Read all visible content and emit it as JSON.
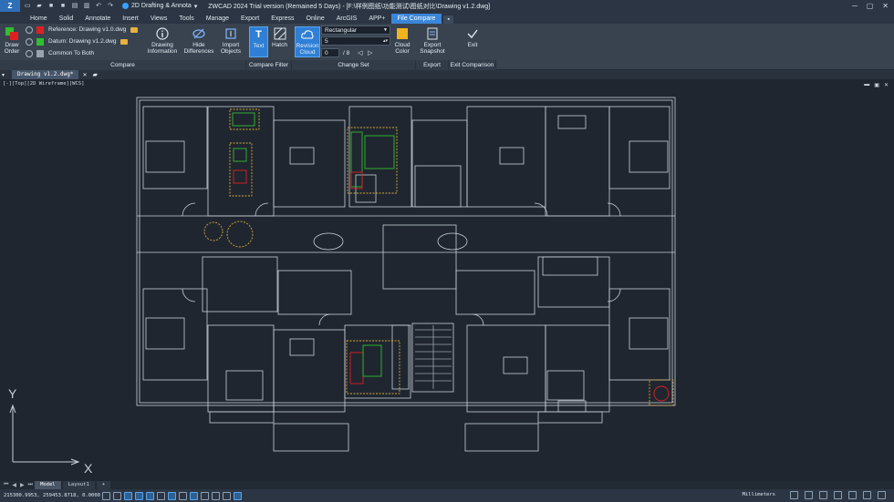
{
  "titlebar": {
    "workspace": "2D Drafting & Annota",
    "title": "ZWCAD 2024 Trial version (Remained 5 Days) - [F:\\样例图纸\\功能测试\\图纸对比\\Drawing v1.2.dwg]"
  },
  "tabs": [
    "Home",
    "Solid",
    "Annotate",
    "Insert",
    "Views",
    "Tools",
    "Manage",
    "Export",
    "Express",
    "Online",
    "ArcGIS",
    "APP+",
    "File Compare"
  ],
  "active_tab": "File Compare",
  "ribbon": {
    "draw_order": "Draw\nOrder",
    "reference_label": "Reference:",
    "reference_file": "Drawing v1.0.dwg",
    "datum_label": "Datum:",
    "datum_file": "Drawing v1.2.dwg",
    "common_label": "Common To Both",
    "drawing_info": "Drawing\nInformation",
    "hide_diff": "Hide\nDifferences",
    "import_objects": "Import\nObjects",
    "text": "Text",
    "hatch": "Hatch",
    "revision_cloud": "Revision\nCloud",
    "shape_value": "Rectangular",
    "size_value": "5",
    "nav_current": "0",
    "nav_total": "/ 8",
    "cloud_color": "Cloud\nColor",
    "export_snapshot": "Export\nSnapshot",
    "exit": "Exit",
    "groups": {
      "compare": "Compare",
      "compare_filter": "Compare Filter",
      "change_set": "Change Set",
      "export": "Export",
      "exit_comparison": "Exit Comparison"
    },
    "colors": {
      "reference": "#e02020",
      "datum": "#2fbf2f",
      "common": "#9aa3ad"
    }
  },
  "doc_tab": "Drawing v1.2.dwg*",
  "view_label": "[-][Top][2D Wireframe][WCS]",
  "layout_tabs": [
    "Model",
    "Layout1",
    "+"
  ],
  "status": {
    "coords": "215300.9953, 259453.8718, 0.0000",
    "units": "Millimeters"
  },
  "ucs": {
    "y": "Y",
    "x": "X"
  }
}
